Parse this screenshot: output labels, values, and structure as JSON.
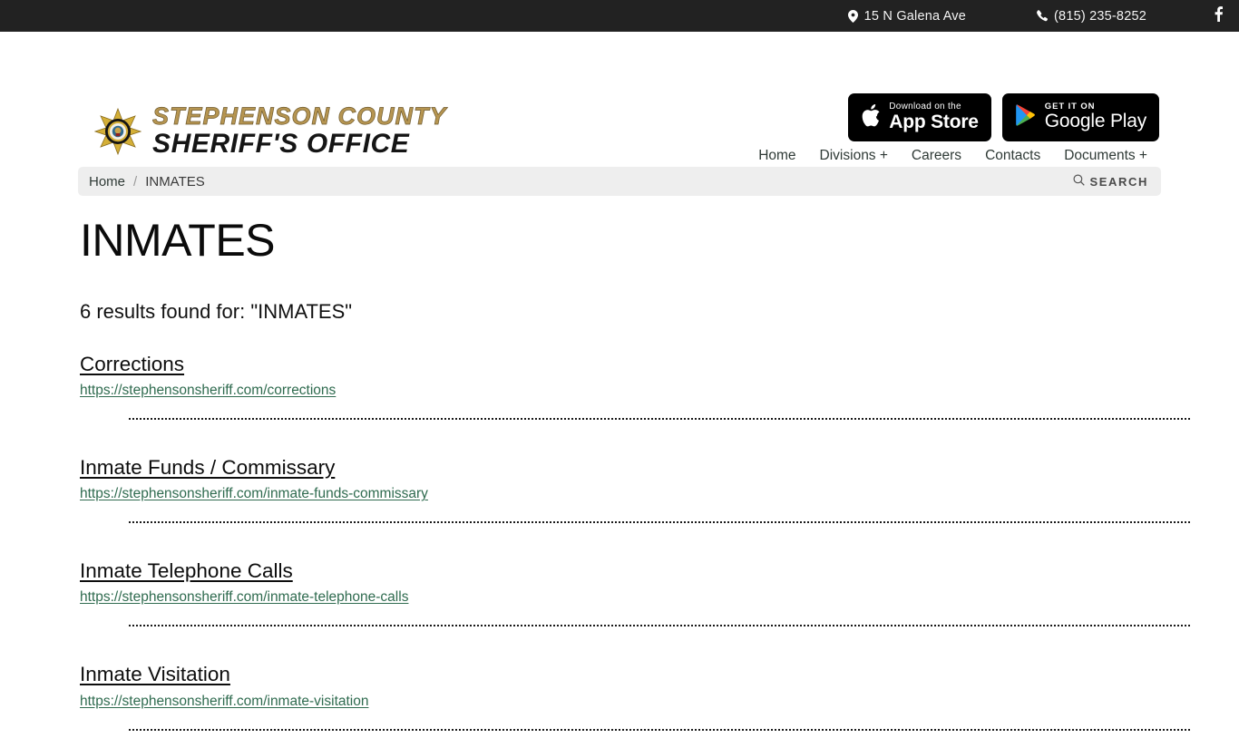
{
  "topbar": {
    "address": "15 N Galena Ave",
    "phone": "(815) 235-8252",
    "address_icon": "map-pin-icon",
    "phone_icon": "phone-icon",
    "social_icon": "facebook-icon"
  },
  "brand": {
    "line1": "STEPHENSON COUNTY",
    "line2": "SHERIFF'S OFFICE",
    "badge_icon": "sheriff-star-badge-icon",
    "gold": "#b69551"
  },
  "store_badges": {
    "apple": {
      "small": "Download on the",
      "big": "App Store",
      "icon": "apple-icon"
    },
    "google": {
      "small": "GET IT ON",
      "big": "Google Play",
      "icon": "google-play-icon"
    }
  },
  "nav": {
    "items": [
      {
        "label": "Home"
      },
      {
        "label": "Divisions +"
      },
      {
        "label": "Careers"
      },
      {
        "label": "Contacts"
      },
      {
        "label": "Documents +"
      }
    ]
  },
  "breadcrumb": {
    "home": "Home",
    "separator": "/",
    "current": "INMATES",
    "search_label": "SEARCH",
    "search_icon": "search-icon"
  },
  "page": {
    "title": "INMATES",
    "results_count_text": "6 results found for: \"INMATES\""
  },
  "results": [
    {
      "title": "Corrections",
      "url": "https://stephensonsheriff.com/corrections"
    },
    {
      "title": "Inmate Funds / Commissary",
      "url": "https://stephensonsheriff.com/inmate-funds-commissary"
    },
    {
      "title": "Inmate Telephone Calls",
      "url": "https://stephensonsheriff.com/inmate-telephone-calls"
    },
    {
      "title": "Inmate Visitation",
      "url": "https://stephensonsheriff.com/inmate-visitation"
    }
  ]
}
